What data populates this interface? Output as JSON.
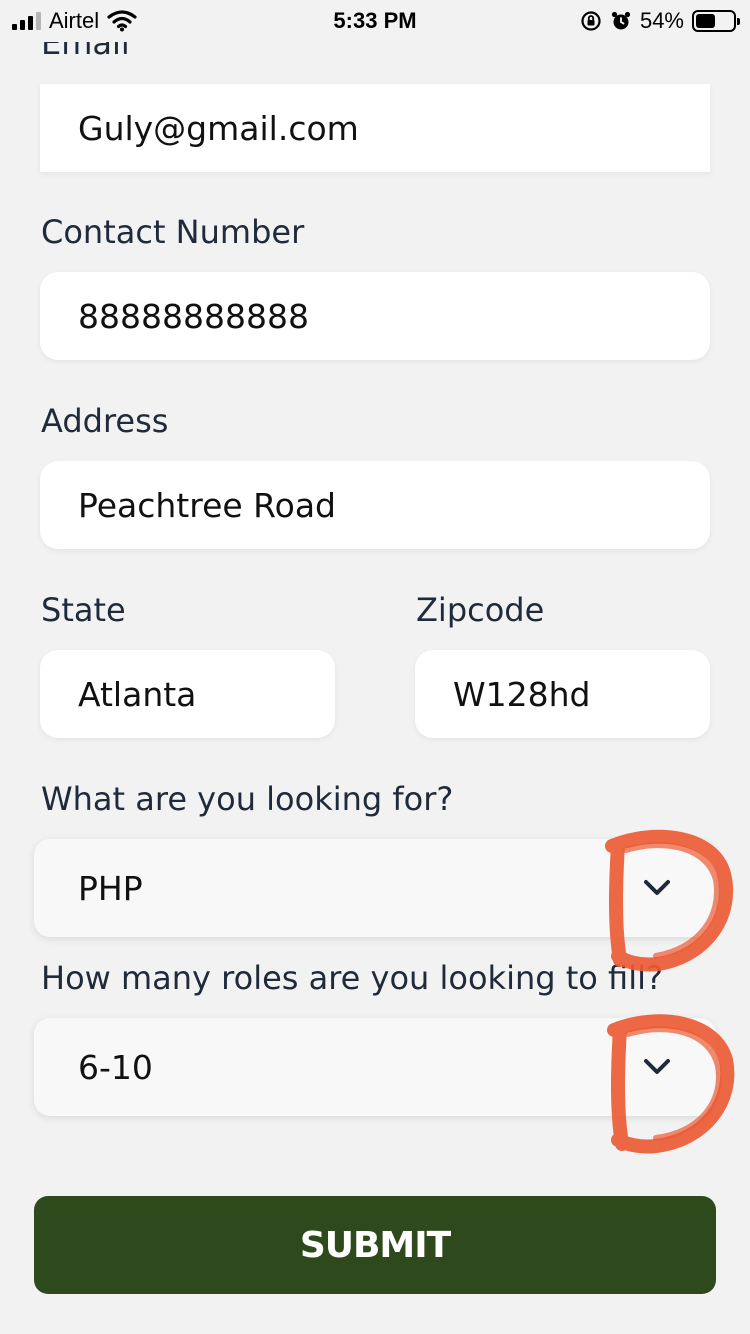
{
  "status_bar": {
    "carrier": "Airtel",
    "time": "5:33 PM",
    "battery": "54%",
    "battery_level": 0.54,
    "icons": [
      "signal-icon",
      "wifi-icon",
      "orientation-lock-icon",
      "alarm-icon",
      "battery-icon"
    ]
  },
  "form": {
    "email": {
      "label": "Email",
      "value": "Guly@gmail.com"
    },
    "contact": {
      "label": "Contact Number",
      "value": "88888888888"
    },
    "address": {
      "label": "Address",
      "value": "Peachtree Road"
    },
    "state": {
      "label": "State",
      "value": "Atlanta"
    },
    "zipcode": {
      "label": "Zipcode",
      "value": "W128hd"
    },
    "looking_for": {
      "label": "What are you looking for?",
      "value": "PHP"
    },
    "roles": {
      "label": "How many roles are you looking to fill?",
      "value": "6-10"
    },
    "submit_label": "SUBMIT"
  },
  "colors": {
    "background": "#f2f2f2",
    "submit": "#2e4a1c",
    "annotation": "#ec5b35",
    "label_text": "#1f2a3a"
  }
}
